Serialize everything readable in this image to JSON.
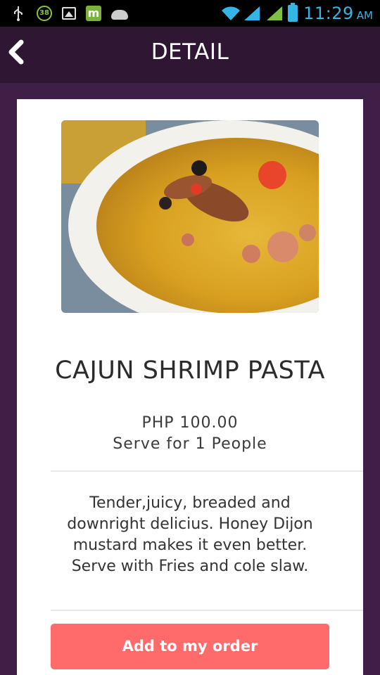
{
  "status_bar": {
    "notification_badge": "38",
    "time": "11:29",
    "ampm": "AM",
    "icons": [
      "usb-icon",
      "badge-38-icon",
      "gallery-icon",
      "market-icon",
      "android-icon",
      "wifi-icon",
      "signal-icon",
      "signal-icon",
      "battery-icon"
    ]
  },
  "appbar": {
    "title": "DETAIL",
    "back_icon": "chevron-left-icon"
  },
  "item": {
    "image": "food-photo",
    "name": "CAJUN SHRIMP PASTA",
    "price": "PHP 100.00",
    "serving": "Serve for 1 People",
    "description": "Tender,juicy, breaded and downright delicius. Honey Dijon mustard makes it even better. Serve with Fries and cole slaw."
  },
  "actions": {
    "add_order_label": "Add to my order"
  },
  "colors": {
    "background": "#3f1f45",
    "appbar": "#2f1633",
    "button": "#ff6b6b",
    "clock": "#33b5e5"
  }
}
